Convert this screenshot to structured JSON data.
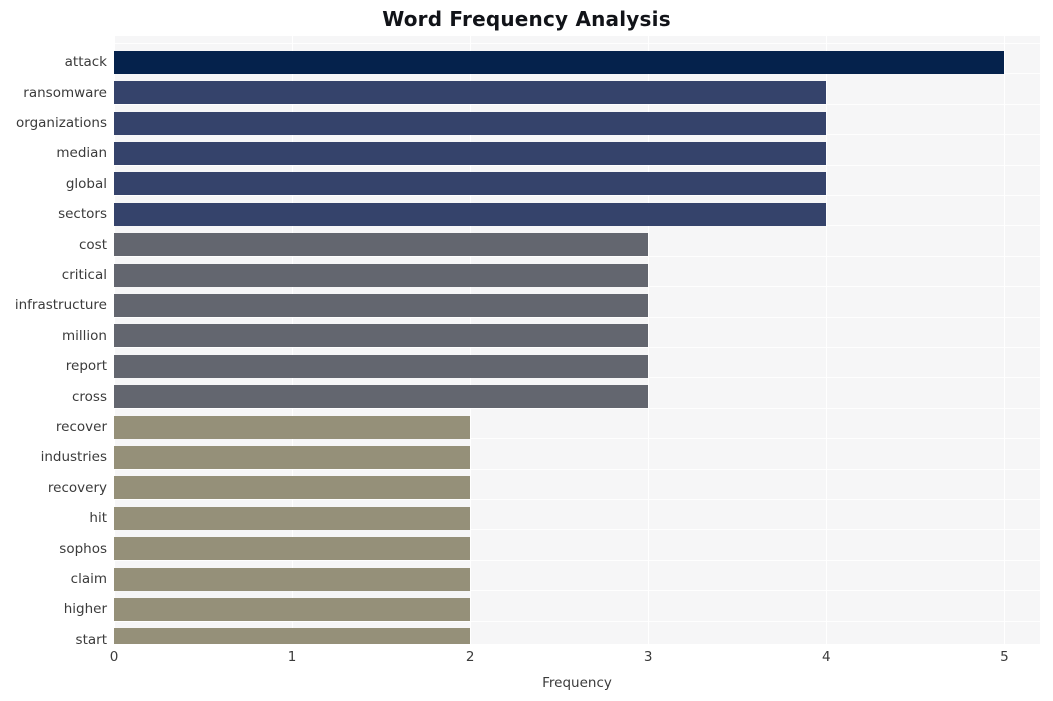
{
  "chart_data": {
    "type": "bar",
    "orientation": "horizontal",
    "title": "Word Frequency Analysis",
    "xlabel": "Frequency",
    "ylabel": "",
    "xlim": [
      0,
      5.2
    ],
    "xticks": [
      0,
      1,
      2,
      3,
      4,
      5
    ],
    "xtick_labels": [
      "0",
      "1",
      "2",
      "3",
      "4",
      "5"
    ],
    "grid": true,
    "legend": "none",
    "categories": [
      "attack",
      "ransomware",
      "organizations",
      "median",
      "global",
      "sectors",
      "cost",
      "critical",
      "infrastructure",
      "million",
      "report",
      "cross",
      "recover",
      "industries",
      "recovery",
      "hit",
      "sophos",
      "claim",
      "higher",
      "start"
    ],
    "values": [
      5,
      4,
      4,
      4,
      4,
      4,
      3,
      3,
      3,
      3,
      3,
      3,
      2,
      2,
      2,
      2,
      2,
      2,
      2,
      2
    ],
    "bar_colors": [
      "#05224c",
      "#35436b",
      "#35436b",
      "#35436b",
      "#35436b",
      "#35436b",
      "#63666f",
      "#63666f",
      "#63666f",
      "#63666f",
      "#63666f",
      "#63666f",
      "#959079",
      "#959079",
      "#959079",
      "#959079",
      "#959079",
      "#959079",
      "#959079",
      "#959079"
    ]
  },
  "style": {
    "plot_background": "#f6f6f7",
    "figure_background": "#ffffff",
    "grid_color": "#ffffff",
    "title_color": "#111318",
    "tick_color": "#3b3b3b"
  }
}
